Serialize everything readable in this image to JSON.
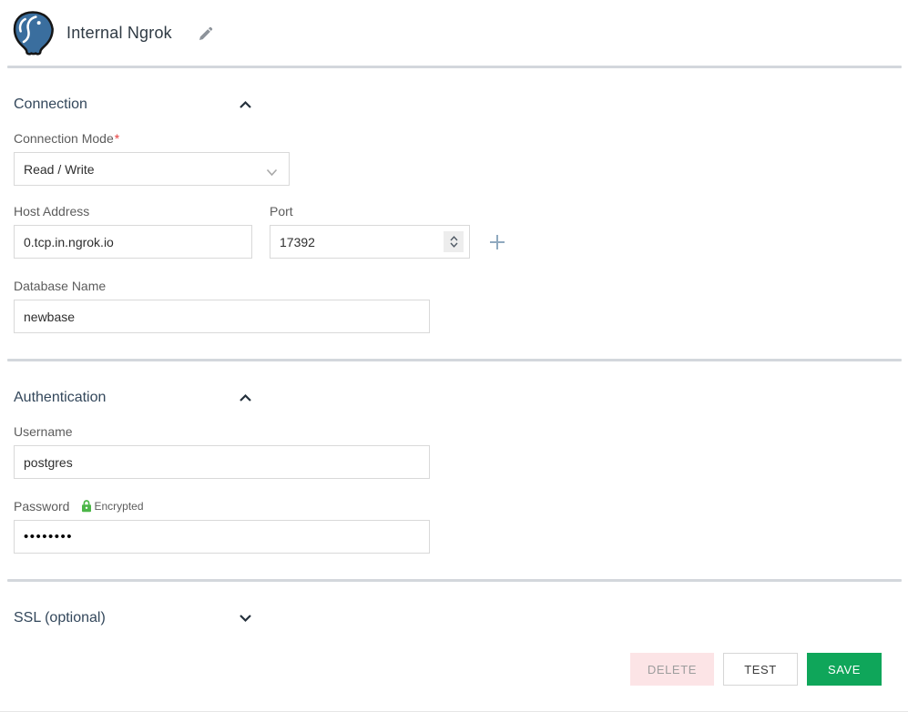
{
  "header": {
    "title": "Internal Ngrok"
  },
  "sections": {
    "connection": {
      "title": "Connection",
      "expanded": true,
      "fields": {
        "connection_mode": {
          "label": "Connection Mode",
          "required_mark": "*",
          "value": "Read / Write"
        },
        "host": {
          "label": "Host Address",
          "value": "0.tcp.in.ngrok.io"
        },
        "port": {
          "label": "Port",
          "value": "17392"
        },
        "database": {
          "label": "Database Name",
          "value": "newbase"
        }
      }
    },
    "authentication": {
      "title": "Authentication",
      "expanded": true,
      "fields": {
        "username": {
          "label": "Username",
          "value": "postgres"
        },
        "password": {
          "label": "Password",
          "badge": "Encrypted",
          "value": "••••••••"
        }
      }
    },
    "ssl": {
      "title": "SSL (optional)",
      "expanded": false
    }
  },
  "buttons": {
    "delete": "DELETE",
    "test": "TEST",
    "save": "SAVE"
  },
  "icons": {
    "logo": "postgresql-elephant-logo",
    "edit": "pencil-edit-icon",
    "section_collapse": "chevron-up-icon",
    "section_expand": "chevron-down-icon",
    "select_open": "chevron-down-icon",
    "port_stepper": "number-stepper-icon",
    "add_host": "plus-icon",
    "encrypted": "lock-icon"
  },
  "colors": {
    "postgres_blue": "#3a6e9e",
    "section_header": "#33475b",
    "divider": "#d3d7dc",
    "save_green": "#0fa65a",
    "delete_pink": "#fce4e6",
    "encrypted_lock_green": "#4cb648",
    "required_red": "#e74040"
  }
}
